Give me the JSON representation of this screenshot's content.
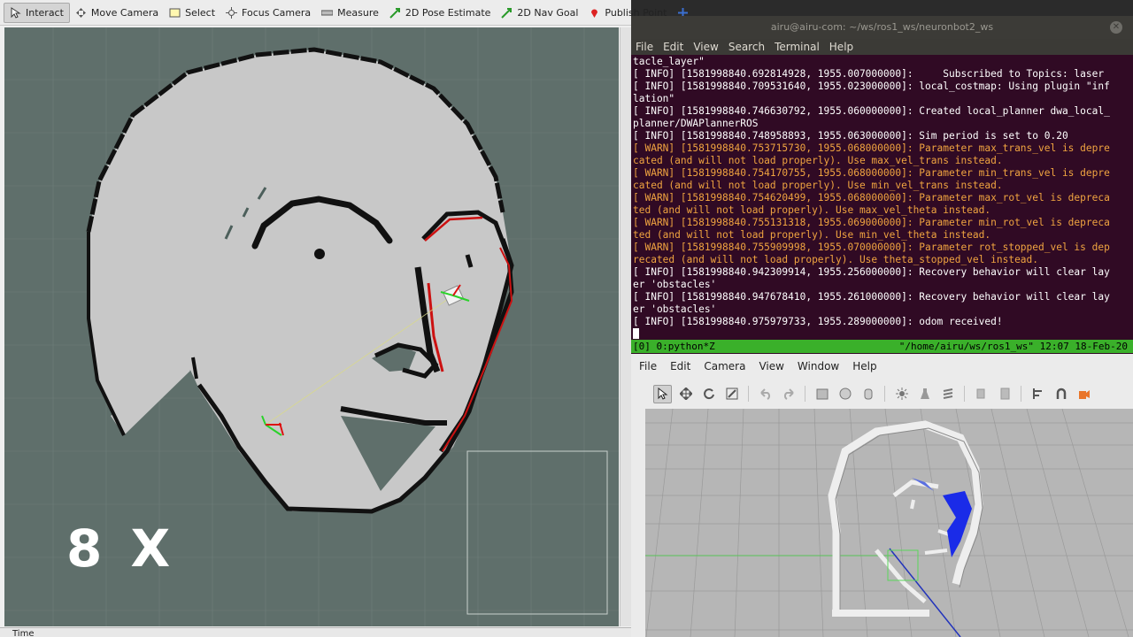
{
  "rviz": {
    "tools": [
      {
        "label": "Interact",
        "icon": "cursor-icon"
      },
      {
        "label": "Move Camera",
        "icon": "move-camera-icon"
      },
      {
        "label": "Select",
        "icon": "select-box-icon"
      },
      {
        "label": "Focus Camera",
        "icon": "focus-camera-icon"
      },
      {
        "label": "Measure",
        "icon": "ruler-icon"
      },
      {
        "label": "2D Pose Estimate",
        "icon": "pose-arrow-icon"
      },
      {
        "label": "2D Nav Goal",
        "icon": "nav-goal-arrow-icon"
      },
      {
        "label": "Publish Point",
        "icon": "map-pin-icon"
      }
    ],
    "zoom_label": "8 X",
    "time_label": "Time",
    "colors": {
      "map_free": "#c9c9c9",
      "map_unknown": "#5f6f6b",
      "wall": "#111111",
      "laser": "#cc1111"
    }
  },
  "terminal": {
    "title": "airu@airu-com: ~/ws/ros1_ws/neuronbot2_ws",
    "menu": [
      "File",
      "Edit",
      "View",
      "Search",
      "Terminal",
      "Help"
    ],
    "lines": [
      {
        "level": "info",
        "text": "tacle_layer\""
      },
      {
        "level": "info",
        "text": "[ INFO] [1581998840.692814928, 1955.007000000]:     Subscribed to Topics: laser"
      },
      {
        "level": "info",
        "text": "[ INFO] [1581998840.709531640, 1955.023000000]: local_costmap: Using plugin \"inf"
      },
      {
        "level": "info",
        "text": "lation\""
      },
      {
        "level": "info",
        "text": "[ INFO] [1581998840.746630792, 1955.060000000]: Created local_planner dwa_local_"
      },
      {
        "level": "info",
        "text": "planner/DWAPlannerROS"
      },
      {
        "level": "info",
        "text": "[ INFO] [1581998840.748958893, 1955.063000000]: Sim period is set to 0.20"
      },
      {
        "level": "warn",
        "text": "[ WARN] [1581998840.753715730, 1955.068000000]: Parameter max_trans_vel is depre"
      },
      {
        "level": "warn",
        "text": "cated (and will not load properly). Use max_vel_trans instead."
      },
      {
        "level": "warn",
        "text": "[ WARN] [1581998840.754170755, 1955.068000000]: Parameter min_trans_vel is depre"
      },
      {
        "level": "warn",
        "text": "cated (and will not load properly). Use min_vel_trans instead."
      },
      {
        "level": "warn",
        "text": "[ WARN] [1581998840.754620499, 1955.068000000]: Parameter max_rot_vel is depreca"
      },
      {
        "level": "warn",
        "text": "ted (and will not load properly). Use max_vel_theta instead."
      },
      {
        "level": "warn",
        "text": "[ WARN] [1581998840.755131318, 1955.069000000]: Parameter min_rot_vel is depreca"
      },
      {
        "level": "warn",
        "text": "ted (and will not load properly). Use min_vel_theta instead."
      },
      {
        "level": "warn",
        "text": "[ WARN] [1581998840.755909998, 1955.070000000]: Parameter rot_stopped_vel is dep"
      },
      {
        "level": "warn",
        "text": "recated (and will not load properly). Use theta_stopped_vel instead."
      },
      {
        "level": "info",
        "text": "[ INFO] [1581998840.942309914, 1955.256000000]: Recovery behavior will clear lay"
      },
      {
        "level": "info",
        "text": "er 'obstacles'"
      },
      {
        "level": "info",
        "text": "[ INFO] [1581998840.947678410, 1955.261000000]: Recovery behavior will clear lay"
      },
      {
        "level": "info",
        "text": "er 'obstacles'"
      },
      {
        "level": "info",
        "text": "[ INFO] [1581998840.975979733, 1955.289000000]: odom received!"
      }
    ],
    "tmux_left": "[0] 0:python*Z",
    "tmux_right": "\"/home/airu/ws/ros1_ws\" 12:07 18-Feb-20",
    "colors": {
      "background": "#300a24",
      "warn": "#f0a440",
      "status": "#3ab02a"
    }
  },
  "gazebo": {
    "menu": [
      "File",
      "Edit",
      "Camera",
      "View",
      "Window",
      "Help"
    ],
    "toolbar_icons": [
      "select-arrow-icon",
      "translate-icon",
      "rotate-icon",
      "scale-icon",
      "undo-icon",
      "redo-icon",
      "box-icon",
      "sphere-icon",
      "cylinder-icon",
      "sun-light-icon",
      "spot-light-icon",
      "directional-light-icon",
      "copy-icon",
      "paste-icon",
      "align-icon",
      "snap-icon",
      "change-view-icon"
    ]
  }
}
